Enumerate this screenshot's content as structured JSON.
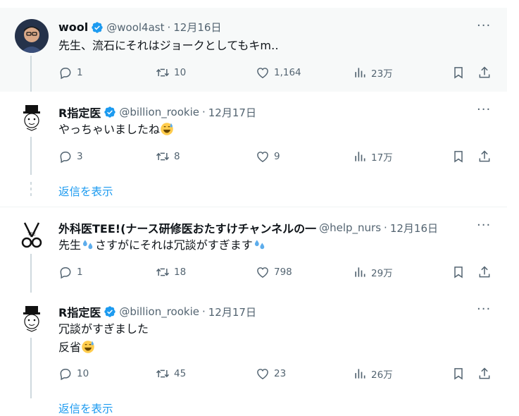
{
  "colors": {
    "accent": "#1d9bf0",
    "muted": "#536471",
    "text": "#0f1419",
    "highlight_bg": "#f7f9f9"
  },
  "tweets": [
    {
      "name": "wool",
      "handle": "@wool4ast",
      "sep": "·",
      "date": "12月16日",
      "lines": [
        "先生、流石にそれはジョークとしてもキm‥"
      ],
      "replies": "1",
      "retweets": "10",
      "likes": "1,164",
      "views": "23万"
    },
    {
      "name": "R指定医",
      "handle": "@billion_rookie",
      "sep": "·",
      "date": "12月17日",
      "lines": [
        "やっちゃいましたね"
      ],
      "replies": "3",
      "retweets": "8",
      "likes": "9",
      "views": "17万",
      "show_replies": "返信を表示"
    },
    {
      "name": "外科医TEE!(ナース研修医おたすけチャンネルの一",
      "handle": "@help_nurs",
      "sep": "·",
      "date": "12月16日",
      "lines": [
        "先生",
        "さすがにそれは冗談がすぎます"
      ],
      "replies": "1",
      "retweets": "18",
      "likes": "798",
      "views": "29万"
    },
    {
      "name": "R指定医",
      "handle": "@billion_rookie",
      "sep": "·",
      "date": "12月17日",
      "lines": [
        "冗談がすぎました",
        "反省"
      ],
      "replies": "10",
      "retweets": "45",
      "likes": "23",
      "views": "26万",
      "show_replies": "返信を表示"
    }
  ],
  "icons": [
    "verified-badge-icon",
    "more-icon",
    "reply-icon",
    "retweet-icon",
    "like-icon",
    "views-icon",
    "bookmark-icon",
    "share-icon",
    "sweat-smile-emoji-icon",
    "sweat-droplets-emoji-icon"
  ]
}
